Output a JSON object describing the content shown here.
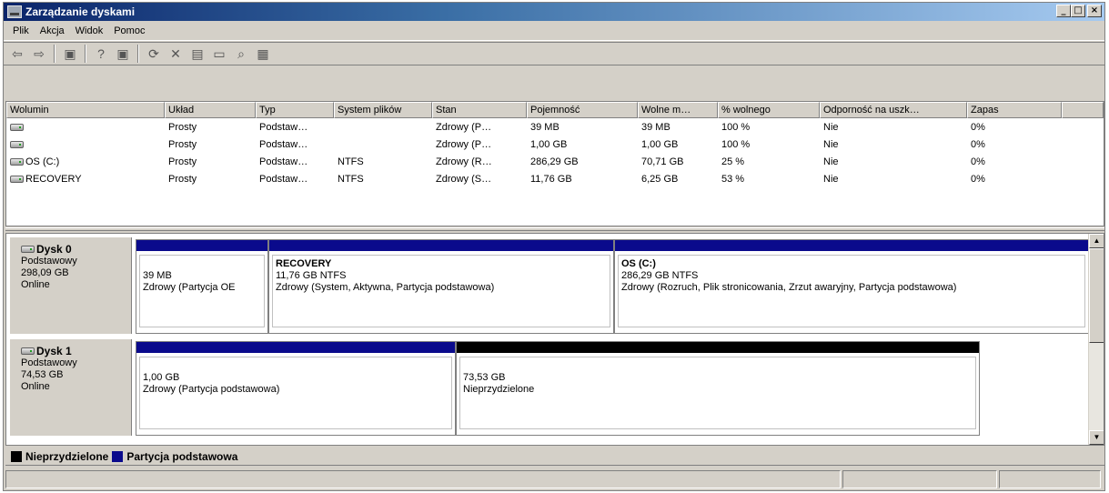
{
  "window": {
    "title": "Zarządzanie dyskami"
  },
  "menu": [
    "Plik",
    "Akcja",
    "Widok",
    "Pomoc"
  ],
  "toolbar": [
    {
      "name": "back-icon",
      "glyph": "⇦"
    },
    {
      "name": "forward-icon",
      "glyph": "⇨"
    },
    {
      "name": "sep"
    },
    {
      "name": "console-tree-icon",
      "glyph": "▣"
    },
    {
      "name": "sep"
    },
    {
      "name": "help-icon",
      "glyph": "?"
    },
    {
      "name": "action-pane-icon",
      "glyph": "▣"
    },
    {
      "name": "sep"
    },
    {
      "name": "refresh-icon",
      "glyph": "⟳"
    },
    {
      "name": "delete-icon",
      "glyph": "✕"
    },
    {
      "name": "properties-icon",
      "glyph": "▤"
    },
    {
      "name": "open-icon",
      "glyph": "▭"
    },
    {
      "name": "search-icon",
      "glyph": "⌕"
    },
    {
      "name": "settings-icon",
      "glyph": "▦"
    }
  ],
  "volume_list": {
    "columns": [
      "Wolumin",
      "Układ",
      "Typ",
      "System plików",
      "Stan",
      "Pojemność",
      "Wolne m…",
      "% wolnego",
      "Odporność na uszk…",
      "Zapas",
      ""
    ],
    "rows": [
      [
        "",
        "Prosty",
        "Podstaw…",
        "",
        "Zdrowy (P…",
        "39 MB",
        "39 MB",
        "100 %",
        "Nie",
        "0%",
        ""
      ],
      [
        "",
        "Prosty",
        "Podstaw…",
        "",
        "Zdrowy (P…",
        "1,00 GB",
        "1,00 GB",
        "100 %",
        "Nie",
        "0%",
        ""
      ],
      [
        "OS (C:)",
        "Prosty",
        "Podstaw…",
        "NTFS",
        "Zdrowy (R…",
        "286,29 GB",
        "70,71 GB",
        "25 %",
        "Nie",
        "0%",
        ""
      ],
      [
        "RECOVERY",
        "Prosty",
        "Podstaw…",
        "NTFS",
        "Zdrowy (S…",
        "11,76 GB",
        "6,25 GB",
        "53 %",
        "Nie",
        "0%",
        ""
      ]
    ]
  },
  "disks": [
    {
      "name": "Dysk 0",
      "type": "Podstawowy",
      "size": "298,09 GB",
      "status": "Online",
      "partitions": [
        {
          "name": "",
          "size": "39 MB",
          "status": "Zdrowy (Partycja OE",
          "bar": "primary"
        },
        {
          "name": "RECOVERY",
          "size": "11,76 GB NTFS",
          "status": "Zdrowy (System, Aktywna, Partycja podstawowa)",
          "bar": "primary"
        },
        {
          "name": "OS  (C:)",
          "size": "286,29 GB NTFS",
          "status": "Zdrowy (Rozruch, Plik stronicowania, Zrzut awaryjny, Partycja podstawowa)",
          "bar": "primary"
        }
      ]
    },
    {
      "name": "Dysk 1",
      "type": "Podstawowy",
      "size": "74,53 GB",
      "status": "Online",
      "partitions": [
        {
          "name": "",
          "size": "1,00 GB",
          "status": "Zdrowy (Partycja podstawowa)",
          "bar": "primary"
        },
        {
          "name": "",
          "size": "73,53 GB",
          "status": "Nieprzydzielone",
          "bar": "unallocated"
        }
      ]
    }
  ],
  "legend": [
    {
      "label": "Nieprzydzielone",
      "color": "#000000"
    },
    {
      "label": "Partycja podstawowa",
      "color": "#0a0a8c"
    }
  ],
  "colors": {
    "primary": "#0a0a8c",
    "unallocated": "#000000",
    "title_start": "#0a246a",
    "title_end": "#a6caf0"
  }
}
